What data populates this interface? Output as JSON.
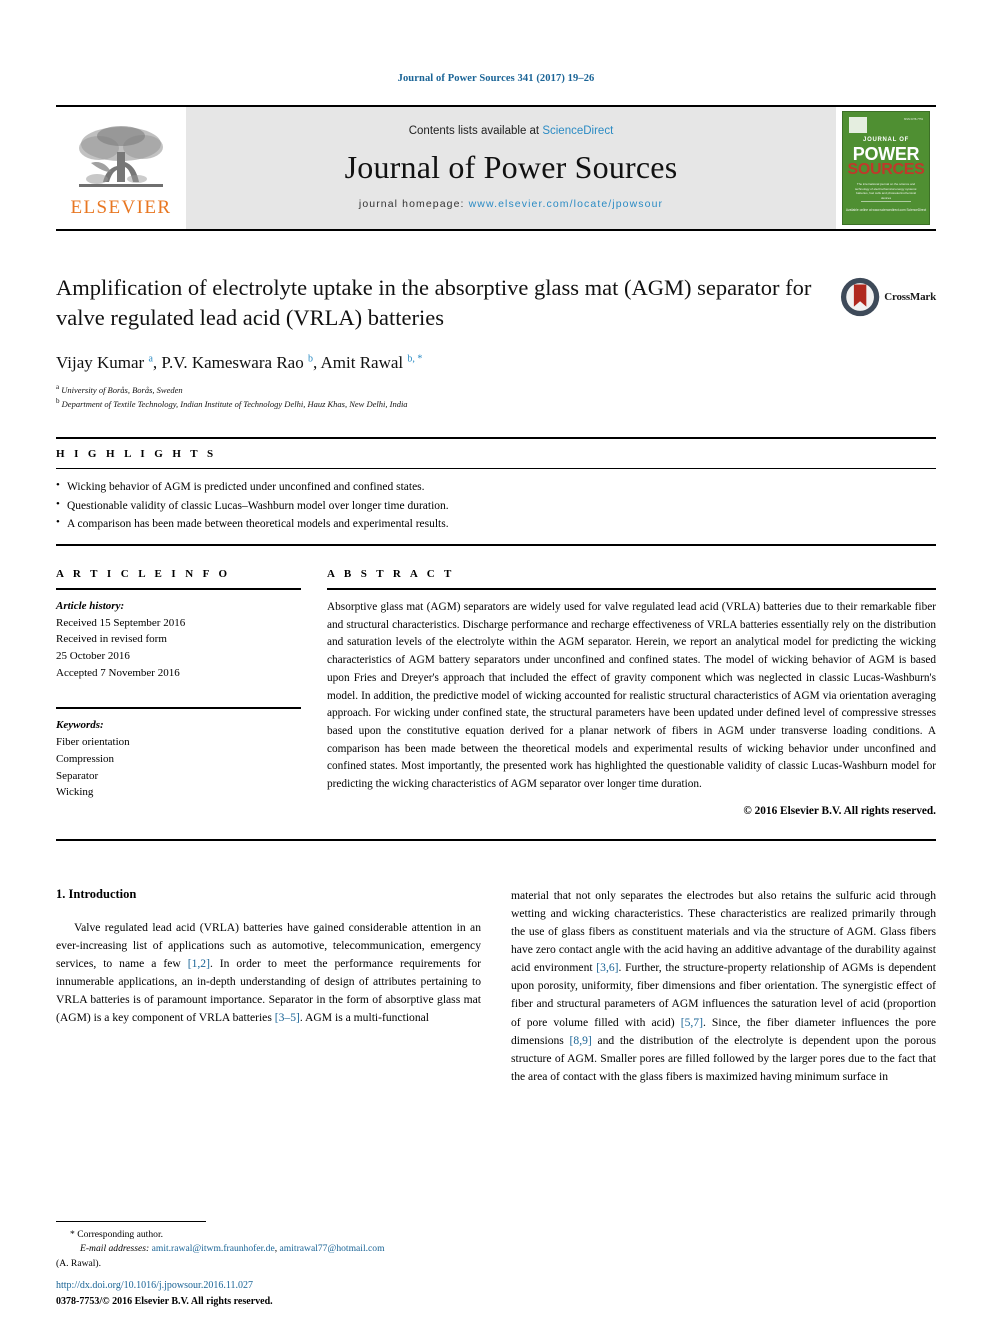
{
  "running_head": "Journal of Power Sources 341 (2017) 19–26",
  "masthead": {
    "publisher_logo_text": "ELSEVIER",
    "contents_prefix": "Contents lists available at ",
    "contents_link": "ScienceDirect",
    "journal_name": "Journal of Power Sources",
    "homepage_prefix": "journal homepage: ",
    "homepage_url": "www.elsevier.com/locate/jpowsour",
    "cover": {
      "issn_tag": "ISSN 0378-7753",
      "line1": "JOURNAL OF",
      "line2": "POWER",
      "line3": "SOURCES",
      "blurb": "The international journal on the science and technology of electrochemical energy systems: batteries, fuel cells and photoelectrochemical devices",
      "footer": "Available online at www.sciencedirect.com\nScienceDirect"
    }
  },
  "article": {
    "title": "Amplification of electrolyte uptake in the absorptive glass mat (AGM) separator for valve regulated lead acid (VRLA) batteries",
    "crossmark_label": "CrossMark",
    "authors_html": "Vijay Kumar <sup>a</sup>, P.V. Kameswara Rao <sup>b</sup>, Amit Rawal <sup>b, *</sup>",
    "affiliations": [
      {
        "marker": "a",
        "text": "University of Borås, Borås, Sweden"
      },
      {
        "marker": "b",
        "text": "Department of Textile Technology, Indian Institute of Technology Delhi, Hauz Khas, New Delhi, India"
      }
    ]
  },
  "highlights": {
    "heading": "H I G H L I G H T S",
    "items": [
      "Wicking behavior of AGM is predicted under unconfined and confined states.",
      "Questionable validity of classic Lucas–Washburn model over longer time duration.",
      "A comparison has been made between theoretical models and experimental results."
    ]
  },
  "article_info": {
    "heading": "A R T I C L E   I N F O",
    "history_label": "Article history:",
    "history_lines": [
      "Received 15 September 2016",
      "Received in revised form",
      "25 October 2016",
      "Accepted 7 November 2016"
    ],
    "keywords_label": "Keywords:",
    "keywords": [
      "Fiber orientation",
      "Compression",
      "Separator",
      "Wicking"
    ]
  },
  "abstract": {
    "heading": "A B S T R A C T",
    "text": "Absorptive glass mat (AGM) separators are widely used for valve regulated lead acid (VRLA) batteries due to their remarkable fiber and structural characteristics. Discharge performance and recharge effectiveness of VRLA batteries essentially rely on the distribution and saturation levels of the electrolyte within the AGM separator. Herein, we report an analytical model for predicting the wicking characteristics of AGM battery separators under unconfined and confined states. The model of wicking behavior of AGM is based upon Fries and Dreyer's approach that included the effect of gravity component which was neglected in classic Lucas-Washburn's model. In addition, the predictive model of wicking accounted for realistic structural characteristics of AGM via orientation averaging approach. For wicking under confined state, the structural parameters have been updated under defined level of compressive stresses based upon the constitutive equation derived for a planar network of fibers in AGM under transverse loading conditions. A comparison has been made between the theoretical models and experimental results of wicking behavior under unconfined and confined states. Most importantly, the presented work has highlighted the questionable validity of classic Lucas-Washburn model for predicting the wicking characteristics of AGM separator over longer time duration.",
    "copyright": "© 2016 Elsevier B.V. All rights reserved."
  },
  "body": {
    "section_number_title": "1. Introduction",
    "left_paragraph_html": "Valve regulated lead acid (VRLA) batteries have gained considerable attention in an ever-increasing list of applications such as automotive, telecommunication, emergency services, to name a few <span class=\"lnk\">[1,2]</span>. In order to meet the performance requirements for innumerable applications, an in-depth understanding of design of attributes pertaining to VRLA batteries is of paramount importance. Separator in the form of absorptive glass mat (AGM) is a key component of VRLA batteries <span class=\"lnk\">[3–5]</span>. AGM is a multi-functional",
    "right_paragraph_html": "material that not only separates the electrodes but also retains the sulfuric acid through wetting and wicking characteristics. These characteristics are realized primarily through the use of glass fibers as constituent materials and via the structure of AGM. Glass fibers have zero contact angle with the acid having an additive advantage of the durability against acid environment <span class=\"lnk\">[3,6]</span>. Further, the structure-property relationship of AGMs is dependent upon porosity, uniformity, fiber dimensions and fiber orientation. The synergistic effect of fiber and structural parameters of AGM influences the saturation level of acid (proportion of pore volume filled with acid) <span class=\"lnk\">[5,7]</span>. Since, the fiber diameter influences the pore dimensions <span class=\"lnk\">[8,9]</span> and the distribution of the electrolyte is dependent upon the porous structure of AGM. Smaller pores are filled followed by the larger pores due to the fact that the area of contact with the glass fibers is maximized having minimum surface in"
  },
  "footer": {
    "corresponding_marker": "*",
    "corresponding_label": "Corresponding author.",
    "email_label": "E-mail addresses:",
    "email_1": "amit.rawal@itwm.fraunhofer.de",
    "email_2": "amitrawal77@hotmail.com",
    "email_owner": "(A. Rawal).",
    "doi": "http://dx.doi.org/10.1016/j.jpowsour.2016.11.027",
    "issn_line": "0378-7753/© 2016 Elsevier B.V. All rights reserved."
  },
  "colors": {
    "link_blue": "#1a6496",
    "science_direct_blue": "#2b8bc4",
    "elsevier_orange": "#E87722",
    "cover_green": "#4f8f32",
    "crossmark_red": "#b0291f"
  }
}
